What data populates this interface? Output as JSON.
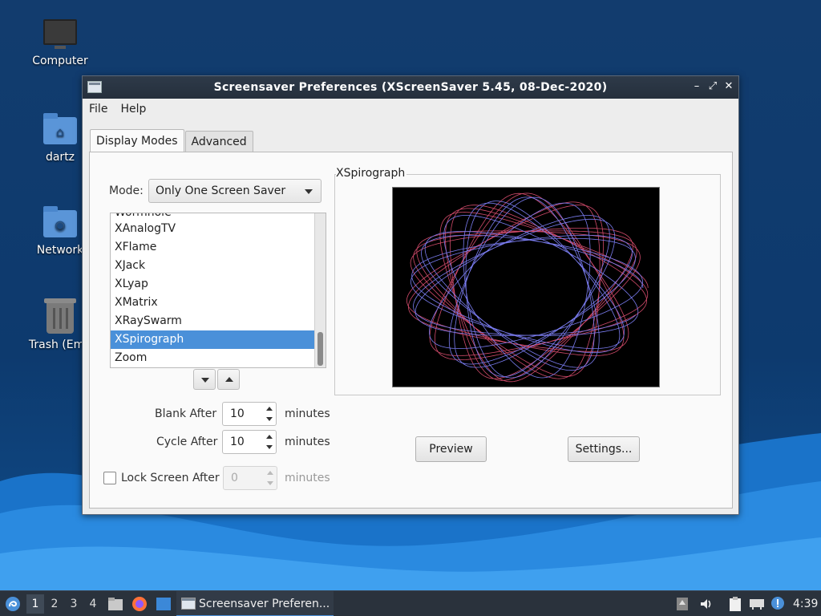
{
  "desktop": {
    "icons": [
      {
        "label": "Computer"
      },
      {
        "label": "dartz"
      },
      {
        "label": "Network"
      },
      {
        "label": "Trash (Emp"
      }
    ]
  },
  "window": {
    "title": "Screensaver Preferences  (XScreenSaver 5.45, 08-Dec-2020)",
    "controls": {
      "minimize": "–",
      "maximize": "⤢",
      "close": "✕"
    },
    "menu": {
      "file": "File",
      "help": "Help"
    },
    "tabs": [
      {
        "label": "Display Modes",
        "active": true
      },
      {
        "label": "Advanced",
        "active": false
      }
    ],
    "mode": {
      "label": "Mode:",
      "value": "Only One Screen Saver"
    },
    "saver_list": {
      "items": [
        "Wormhole",
        "XAnalogTV",
        "XFlame",
        "XJack",
        "XLyap",
        "XMatrix",
        "XRaySwarm",
        "XSpirograph",
        "Zoom"
      ],
      "selected": "XSpirograph"
    },
    "blank_after": {
      "label": "Blank After",
      "value": "10",
      "unit": "minutes"
    },
    "cycle_after": {
      "label": "Cycle After",
      "value": "10",
      "unit": "minutes"
    },
    "lock_after": {
      "label": "Lock Screen After",
      "value": "0",
      "unit": "minutes",
      "checked": false
    },
    "preview_frame": {
      "label": "XSpirograph"
    },
    "buttons": {
      "preview": "Preview",
      "settings": "Settings..."
    }
  },
  "taskbar": {
    "workspaces": [
      "1",
      "2",
      "3",
      "4"
    ],
    "active_workspace": "1",
    "app_title": "Screensaver Preferen...",
    "clock": "4:39"
  },
  "colors": {
    "selection": "#4a90d9",
    "titlebar": "#2b3644",
    "taskbar": "#2a323c",
    "desktop": "#0d3a6e",
    "spiro_red": "#d04a6a",
    "spiro_blue": "#7a7cf0"
  }
}
